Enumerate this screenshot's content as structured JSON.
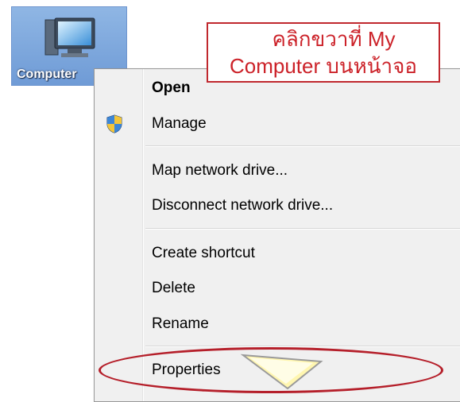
{
  "desktop_icon": {
    "label": "Computer",
    "icon": "computer-monitor-icon"
  },
  "callout": {
    "line1": "คลิกขวาที่ My",
    "line2": "Computer บนหน้าจอ",
    "color": "#cc2229"
  },
  "context_menu": {
    "items": [
      {
        "label": "Open",
        "default": true
      },
      {
        "label": "Manage",
        "icon": "uac-shield-icon"
      },
      {
        "label": "Map network drive..."
      },
      {
        "label": "Disconnect network drive..."
      },
      {
        "label": "Create shortcut"
      },
      {
        "label": "Delete"
      },
      {
        "label": "Rename"
      },
      {
        "label": "Properties",
        "highlighted": true
      }
    ]
  },
  "colors": {
    "highlight_ring": "#b51f2a",
    "pointer": "#fff6b0"
  }
}
